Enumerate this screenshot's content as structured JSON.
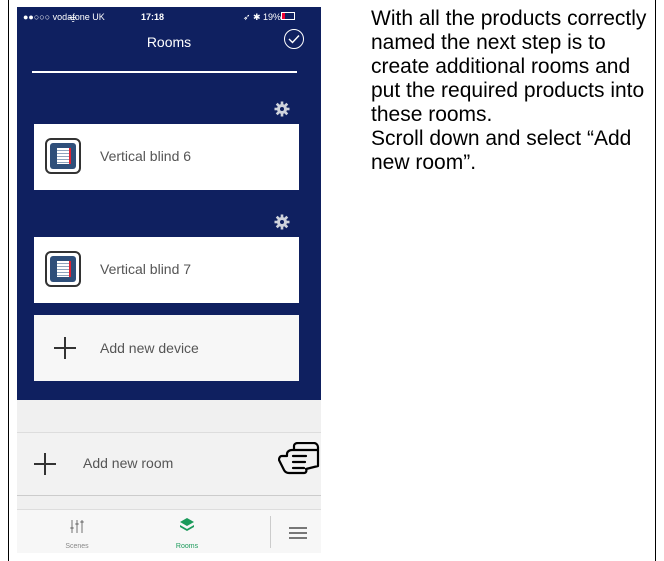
{
  "status_bar": {
    "carrier": "●●○○○ vodafone UK",
    "time": "17:18",
    "battery": "19%"
  },
  "nav": {
    "title": "Rooms"
  },
  "devices": [
    {
      "label": "Vertical blind 6"
    },
    {
      "label": "Vertical blind 7"
    }
  ],
  "add_device_label": "Add new device",
  "add_room_label": "Add new room",
  "tabs": [
    {
      "label": "Scenes"
    },
    {
      "label": "Rooms"
    }
  ],
  "instructions": [
    "With all the products correctly named the next step is to create additional rooms and put the required products into these rooms.",
    "Scroll down and select “Add new room”."
  ],
  "colors": {
    "nav_blue": "#0f2060",
    "active_tab": "#1a9a5a"
  }
}
